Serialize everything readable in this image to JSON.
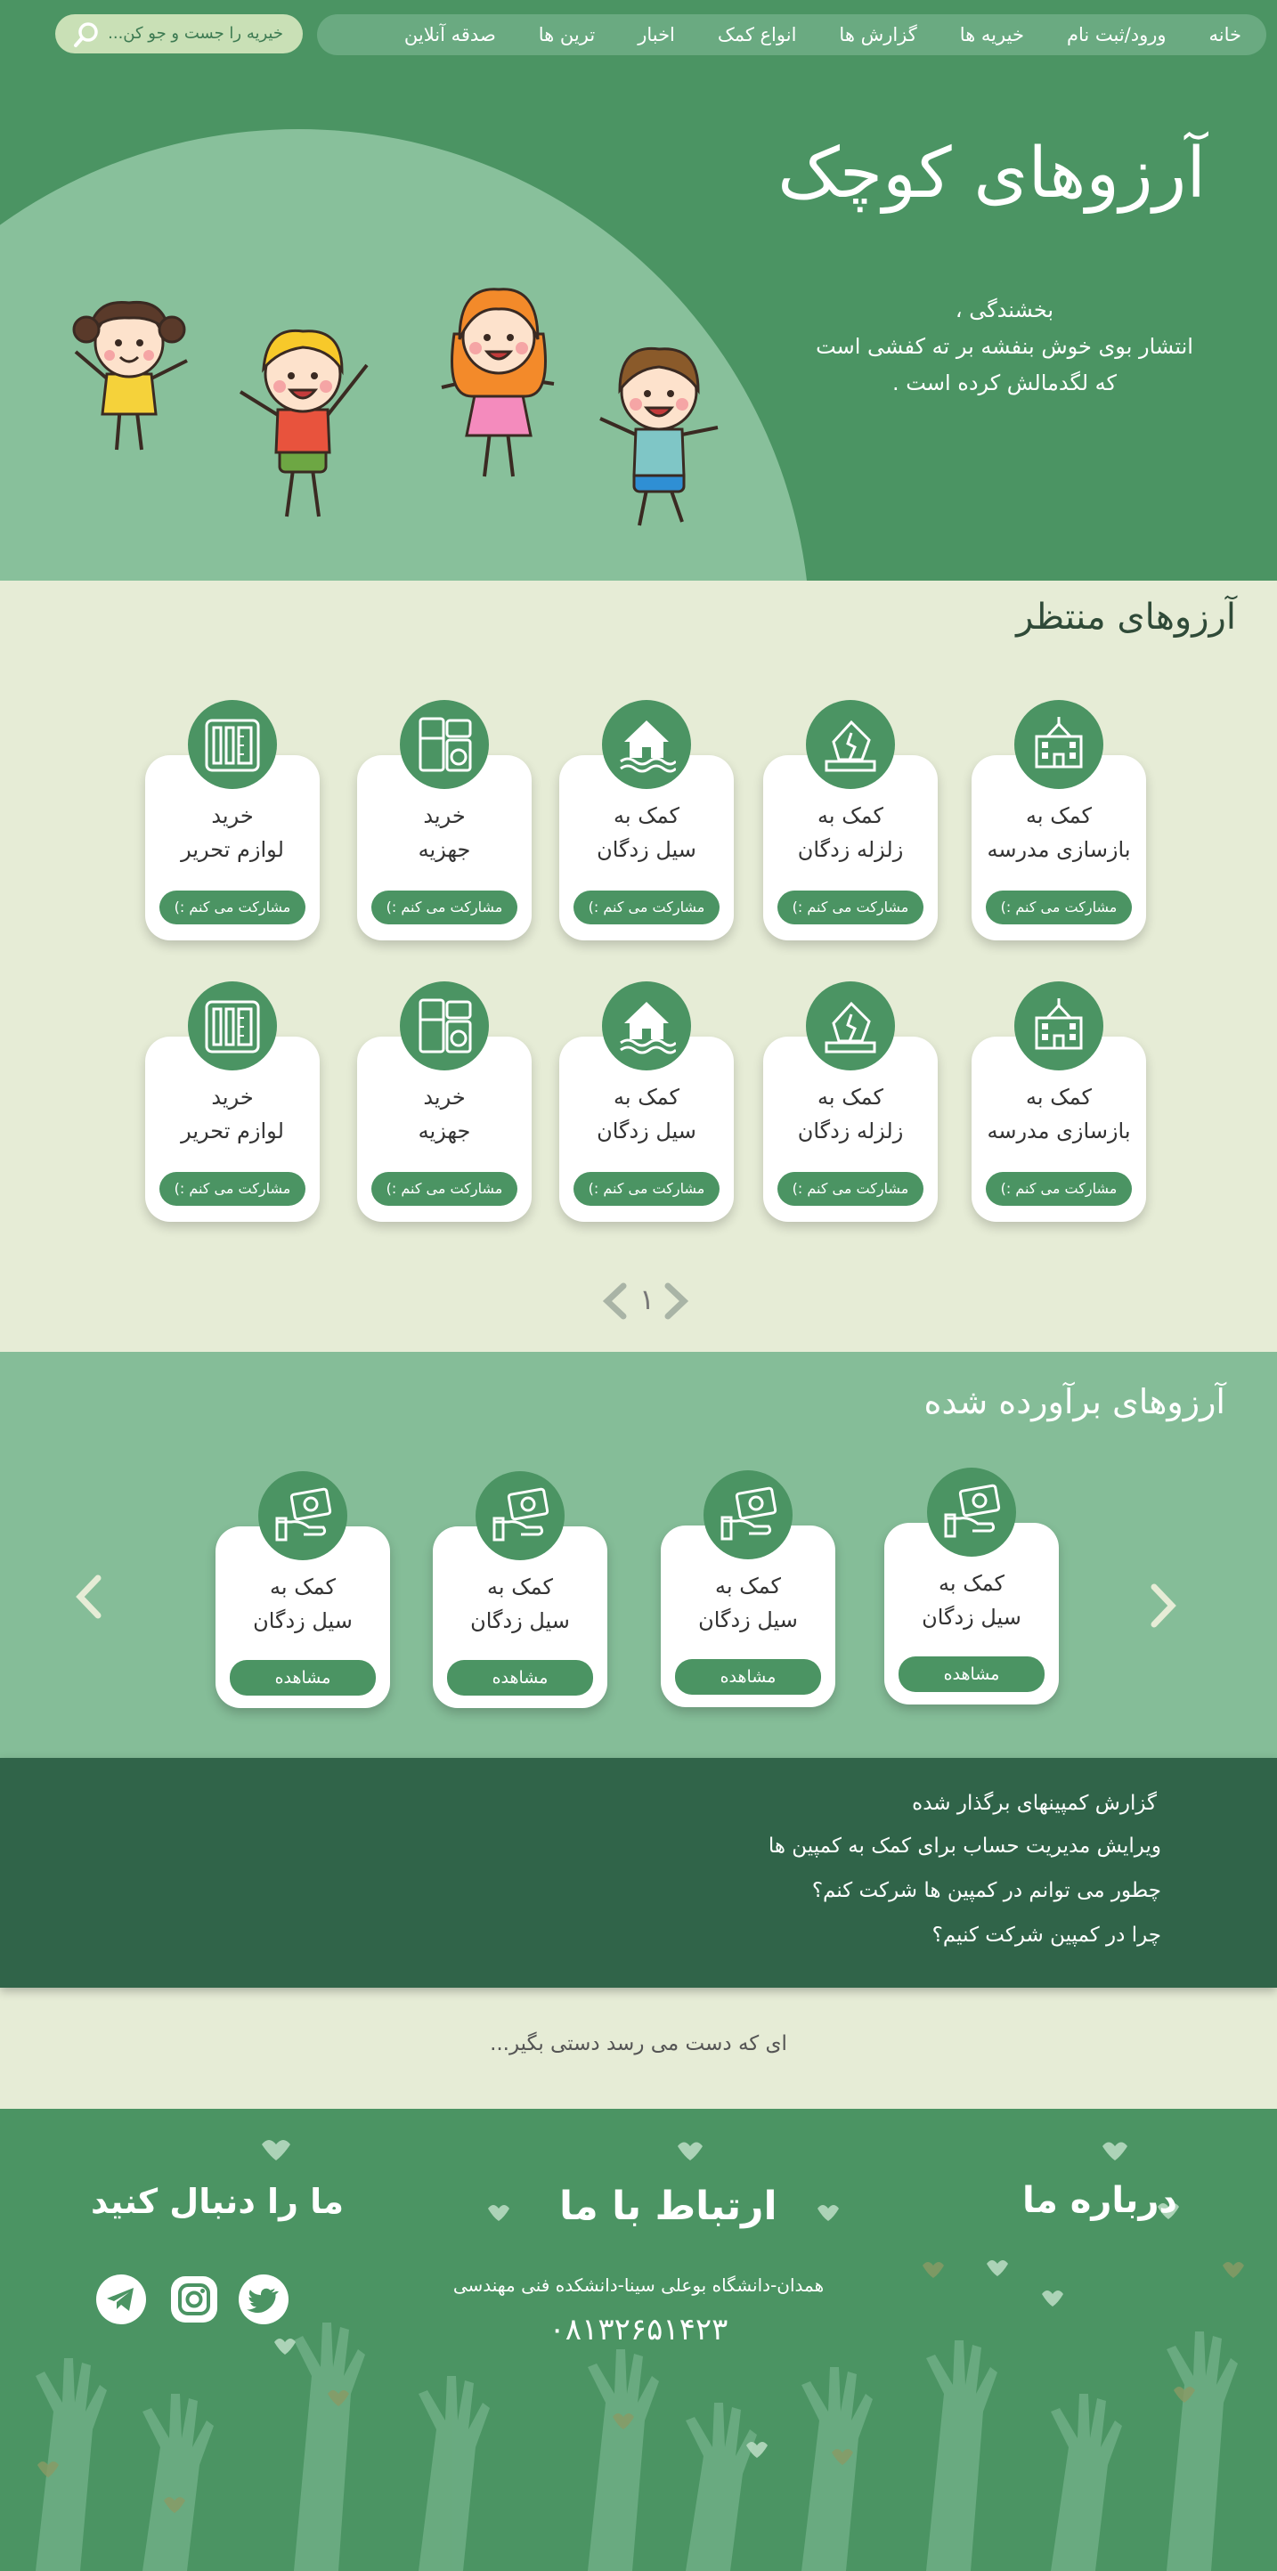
{
  "nav": {
    "items": [
      "خانه",
      "ورود/ثبت نام",
      "خیریه ها",
      "گزارش ها",
      "انواع کمک",
      "اخبار",
      "ترین ها",
      "صدقه آنلاین"
    ],
    "search_placeholder": "خیریه را جست و جو کن..."
  },
  "hero": {
    "title": "آرزوهای کوچک",
    "line1": "بخشندگی ،",
    "line2": "انتشار بوی خوش بنفشه بر ته کفشی است",
    "line3": "که لگدمالش کرده است ."
  },
  "pending": {
    "title": "آرزوهای منتظر",
    "button_label": "مشارکت می کنم :)",
    "cards": [
      {
        "line1": "کمک به",
        "line2": "بازسازی مدرسه",
        "icon": "school-icon"
      },
      {
        "line1": "کمک به",
        "line2": "زلزله زدگان",
        "icon": "earthquake-house-icon"
      },
      {
        "line1": "کمک به",
        "line2": "سیل زدگان",
        "icon": "flood-house-icon"
      },
      {
        "line1": "خرید",
        "line2": "جهزیه",
        "icon": "appliances-icon"
      },
      {
        "line1": "خرید",
        "line2": "لوازم تحریر",
        "icon": "stationery-icon"
      },
      {
        "line1": "کمک به",
        "line2": "بازسازی مدرسه",
        "icon": "school-icon"
      },
      {
        "line1": "کمک به",
        "line2": "زلزله زدگان",
        "icon": "earthquake-house-icon"
      },
      {
        "line1": "کمک به",
        "line2": "سیل زدگان",
        "icon": "flood-house-icon"
      },
      {
        "line1": "خرید",
        "line2": "جهزیه",
        "icon": "appliances-icon"
      },
      {
        "line1": "خرید",
        "line2": "لوازم تحریر",
        "icon": "stationery-icon"
      }
    ],
    "page_number": "۱"
  },
  "fulfilled": {
    "title": "آرزوهای برآورده شده",
    "button_label": "مشاهده",
    "cards": [
      {
        "line1": "کمک به",
        "line2": "سیل زدگان",
        "icon": "money-hand-icon"
      },
      {
        "line1": "کمک به",
        "line2": "سیل زدگان",
        "icon": "money-hand-icon"
      },
      {
        "line1": "کمک به",
        "line2": "سیل زدگان",
        "icon": "money-hand-icon"
      },
      {
        "line1": "کمک به",
        "line2": "سیل زدگان",
        "icon": "money-hand-icon"
      }
    ]
  },
  "faq": {
    "items": [
      "گزارش کمپینهای برگذار شده",
      "ویرایش مدیریت حساب برای کمک به کمپین ها",
      "چطور می توانم در کمپین ها شرکت کنم؟",
      "چرا در کمپین شرکت کنیم؟"
    ]
  },
  "quote": "ای که دست می رسد دستی بگیر...",
  "footer": {
    "about_title": "درباره ما",
    "contact_title": "ارتباط با ما",
    "follow_title": "ما را دنبال کنید",
    "address": "همدان-دانشگاه بوعلی سینا-دانشکده فنی مهندسی",
    "phone": "۰۸۱۳۲۶۵۱۴۲۳",
    "socials": [
      "twitter-icon",
      "instagram-icon",
      "telegram-icon"
    ]
  },
  "colors": {
    "primary": "#4b9463",
    "light_green": "#85bd98",
    "dark_green": "#306449",
    "background": "#e6ecd6"
  }
}
